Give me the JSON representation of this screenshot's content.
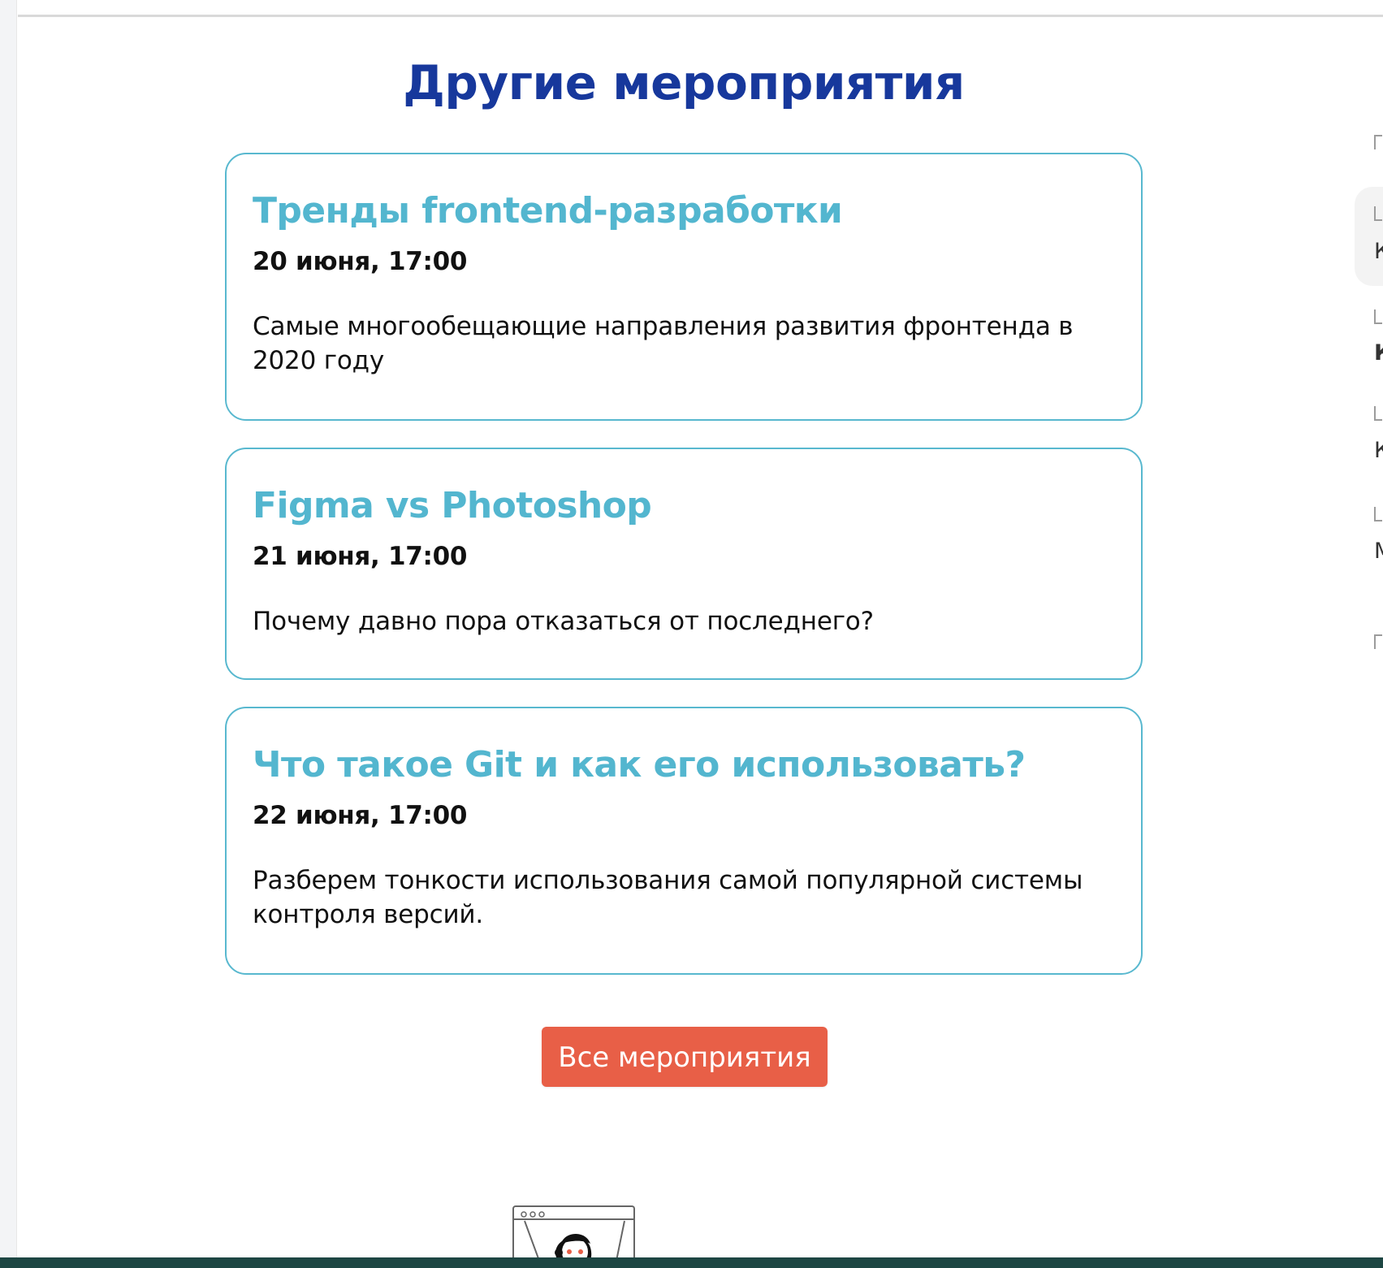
{
  "section": {
    "title": "Другие мероприятия"
  },
  "events": [
    {
      "title": "Тренды frontend-разработки",
      "date": "20 июня, 17:00",
      "description": "Самые многообещающие направления развития фронтенда в 2020 году"
    },
    {
      "title": "Figma vs Photoshop",
      "date": "21 июня, 17:00",
      "description": "Почему давно пора отказаться от последнего?"
    },
    {
      "title": "Что такое Git и как его использовать?",
      "date": "22 июня, 17:00",
      "description": "Разберем тонкости использования самой популярной системы контроля версий."
    }
  ],
  "actions": {
    "all_events": "Все мероприятия"
  },
  "sidebar": {
    "fragments": [
      "К",
      "К",
      "К",
      "М"
    ]
  },
  "colors": {
    "title": "#17389c",
    "event_title": "#53b6cf",
    "card_border": "#58b8cf",
    "button": "#e85f47",
    "footer": "#1d4643"
  },
  "icons": {
    "illustration": "browser-window-illustration"
  }
}
